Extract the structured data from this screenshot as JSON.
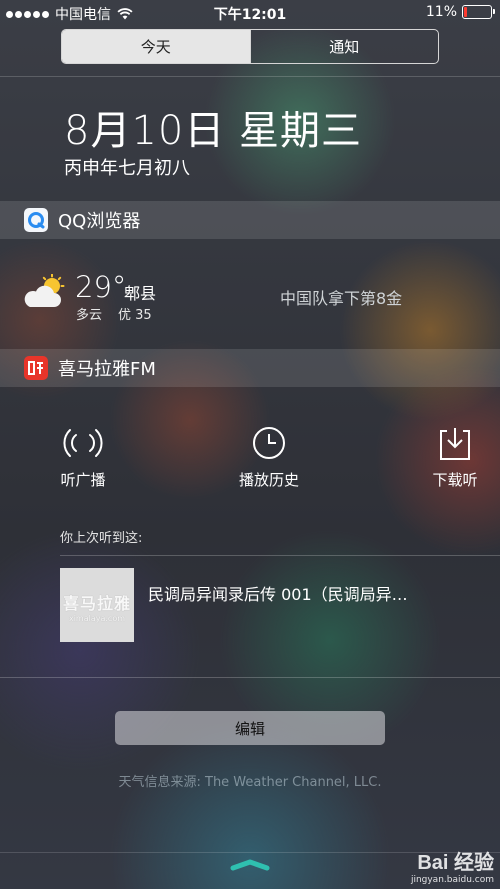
{
  "status_bar": {
    "carrier": "中国电信",
    "time": "下午12:01",
    "battery_text": "11%",
    "battery_level": 0.11,
    "battery_color": "#ff3b30"
  },
  "tabs": [
    {
      "label": "今天",
      "selected": true
    },
    {
      "label": "通知",
      "selected": false
    }
  ],
  "date": {
    "main": "8月10日 星期三",
    "lunar": "丙申年七月初八"
  },
  "qq_browser": {
    "title": "QQ浏览器",
    "icon": "qq-browser-icon",
    "weather_icon": "partly-cloudy-icon",
    "temperature": "29°",
    "city": "郫县",
    "condition": "多云",
    "aqi": "优 35",
    "headline": "中国队拿下第8金"
  },
  "ximalaya": {
    "title": "喜马拉雅FM",
    "icon": "ximalaya-icon",
    "brand_color": "#e8352a",
    "buttons": [
      {
        "label": "听广播",
        "icon": "broadcast-icon"
      },
      {
        "label": "播放历史",
        "icon": "clock-icon"
      },
      {
        "label": "下载听",
        "icon": "download-icon"
      }
    ],
    "last_listened_label": "你上次听到这:",
    "thumb_title": "喜马拉雅",
    "thumb_url": "ximalaya.com",
    "track_title": "民调局异闻录后传 001（民调局异…"
  },
  "edit_button": "编辑",
  "source_text": "天气信息来源: The Weather Channel, LLC.",
  "watermark": {
    "logo": "Bai 经验",
    "url": "jingyan.baidu.com"
  }
}
